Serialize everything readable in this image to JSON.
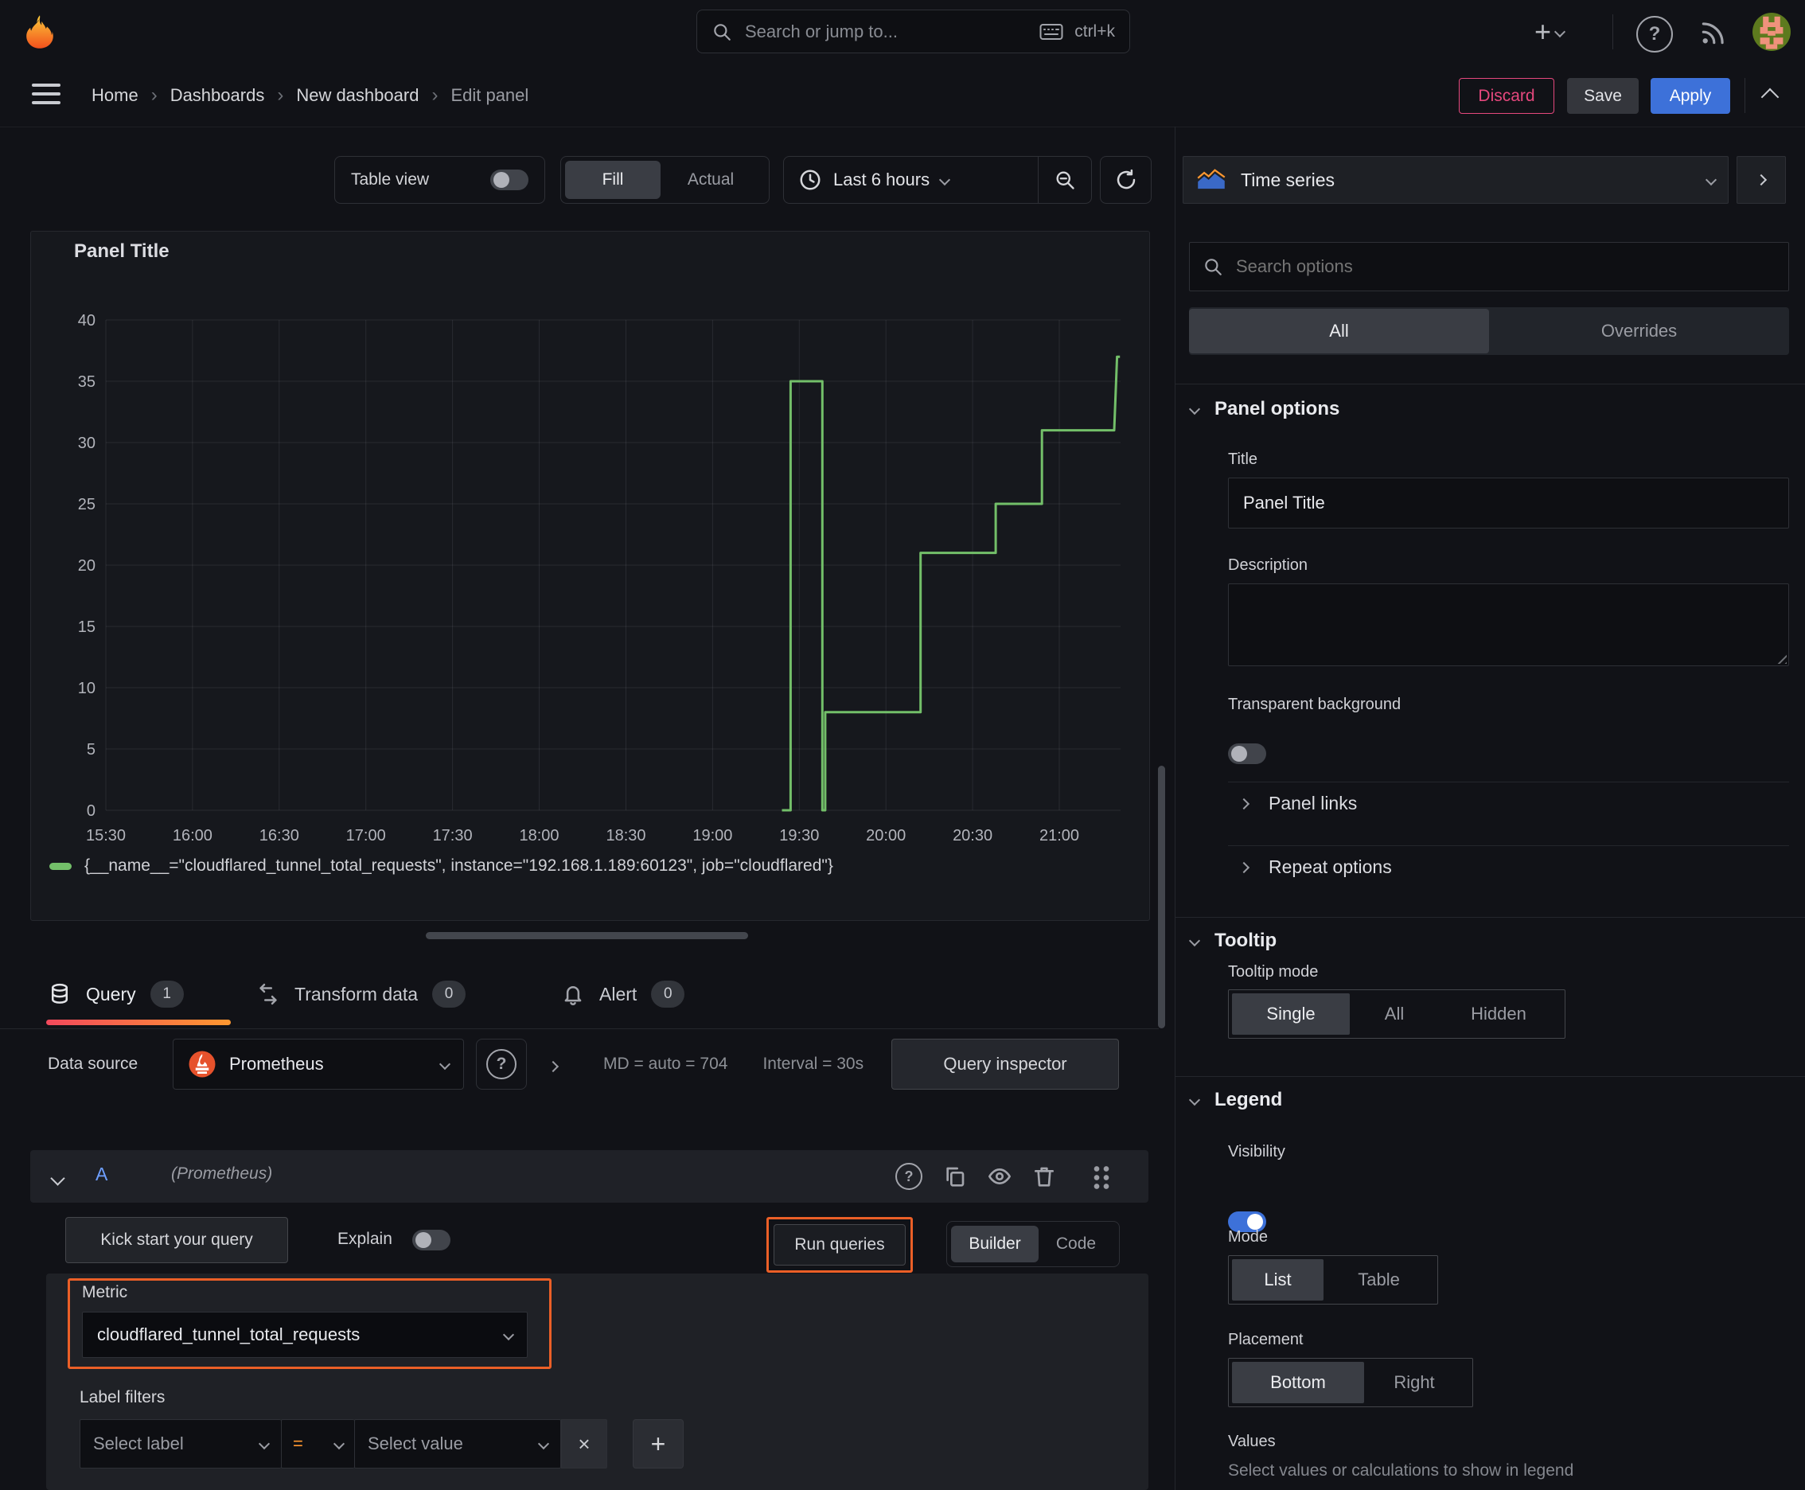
{
  "app": {
    "search_placeholder": "Search or jump to...",
    "shortcut": "ctrl+k"
  },
  "breadcrumb": {
    "items": [
      "Home",
      "Dashboards",
      "New dashboard",
      "Edit panel"
    ]
  },
  "header_actions": {
    "discard": "Discard",
    "save": "Save",
    "apply": "Apply"
  },
  "toolbar": {
    "table_view": "Table view",
    "fill": "Fill",
    "actual": "Actual",
    "time_range": "Last 6 hours"
  },
  "viz_picker": {
    "label": "Time series"
  },
  "options": {
    "search_placeholder": "Search options",
    "tabs": {
      "all": "All",
      "overrides": "Overrides"
    },
    "panel_options": {
      "heading": "Panel options",
      "title_label": "Title",
      "title_value": "Panel Title",
      "description_label": "Description",
      "transparent_label": "Transparent background"
    },
    "links": {
      "panel_links": "Panel links",
      "repeat_options": "Repeat options"
    },
    "tooltip": {
      "heading": "Tooltip",
      "mode_label": "Tooltip mode",
      "modes": [
        "Single",
        "All",
        "Hidden"
      ],
      "selected": "Single"
    },
    "legend": {
      "heading": "Legend",
      "visibility_label": "Visibility",
      "mode_label": "Mode",
      "modes": [
        "List",
        "Table"
      ],
      "selected_mode": "List",
      "placement_label": "Placement",
      "placements": [
        "Bottom",
        "Right"
      ],
      "selected_placement": "Bottom",
      "values_label": "Values",
      "values_hint": "Select values or calculations to show in legend"
    }
  },
  "query_tabs": {
    "query": "Query",
    "query_count": "1",
    "transform": "Transform data",
    "transform_count": "0",
    "alert": "Alert",
    "alert_count": "0"
  },
  "datasource": {
    "label": "Data source",
    "name": "Prometheus",
    "stats": "MD = auto = 704",
    "interval": "Interval = 30s",
    "inspector": "Query inspector"
  },
  "query_row": {
    "ref_id": "A",
    "datasource_hint": "(Prometheus)"
  },
  "query_editor": {
    "kick_start": "Kick start your query",
    "explain": "Explain",
    "run_queries": "Run queries",
    "builder": "Builder",
    "code": "Code",
    "metric_label": "Metric",
    "metric_value": "cloudflared_tunnel_total_requests",
    "label_filters_label": "Label filters",
    "select_label": "Select label",
    "op": "=",
    "select_value": "Select value"
  },
  "colors": {
    "accent_blue": "#3d71d9",
    "danger_pink": "#e5487d",
    "highlight_orange": "#eb5f27",
    "series_green": "#73bf69"
  },
  "chart_data": {
    "type": "line",
    "title": "Panel Title",
    "xlabel": "",
    "ylabel": "",
    "x_ticks": [
      "15:30",
      "16:00",
      "16:30",
      "17:00",
      "17:30",
      "18:00",
      "18:30",
      "19:00",
      "19:30",
      "20:00",
      "20:30",
      "21:00"
    ],
    "y_ticks": [
      0,
      5,
      10,
      15,
      20,
      25,
      30,
      35,
      40
    ],
    "ylim": [
      0,
      40
    ],
    "x_minutes_domain": [
      0,
      351
    ],
    "grid": true,
    "legend_position": "bottom",
    "series": [
      {
        "name": "{__name__=\"cloudflared_tunnel_total_requests\", instance=\"192.168.1.189:60123\", job=\"cloudflared\"}",
        "color": "#73bf69",
        "points_min_val": [
          [
            234,
            0
          ],
          [
            237,
            0
          ],
          [
            237,
            35
          ],
          [
            248,
            35
          ],
          [
            248,
            0
          ],
          [
            249,
            0
          ],
          [
            249,
            8
          ],
          [
            282,
            8
          ],
          [
            282,
            21
          ],
          [
            308,
            21
          ],
          [
            308,
            25
          ],
          [
            324,
            25
          ],
          [
            324,
            31
          ],
          [
            349,
            31
          ],
          [
            350,
            37
          ],
          [
            351,
            37
          ]
        ]
      }
    ]
  }
}
